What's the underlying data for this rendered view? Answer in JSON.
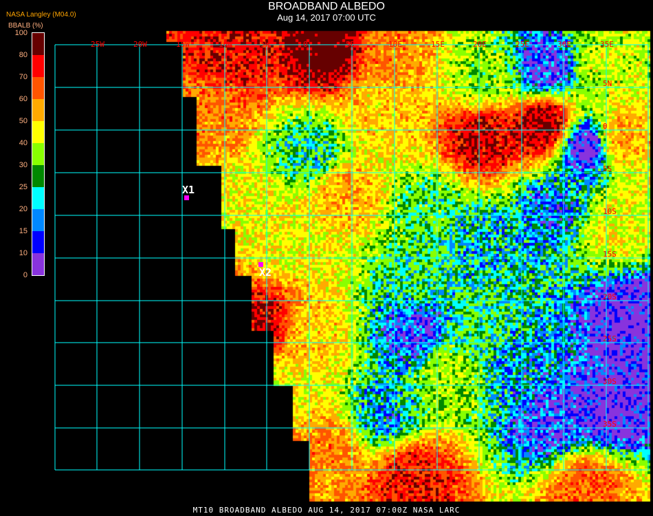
{
  "header": {
    "title": "BROADBAND ALBEDO",
    "subtitle": "Aug 14, 2017 07:00 UTC"
  },
  "legend": {
    "source": "NASA Langley (M04.0)",
    "parameter": "BBALB (%)",
    "ticks": [
      "100",
      "80",
      "70",
      "60",
      "50",
      "40",
      "30",
      "25",
      "20",
      "15",
      "10",
      "0"
    ],
    "bins": [
      {
        "range": "80-100",
        "color": "#660000"
      },
      {
        "range": "70-80",
        "color": "#ff0000"
      },
      {
        "range": "60-70",
        "color": "#ff5500"
      },
      {
        "range": "50-60",
        "color": "#ffaa00"
      },
      {
        "range": "40-50",
        "color": "#ffff00"
      },
      {
        "range": "30-40",
        "color": "#88ff00"
      },
      {
        "range": "25-30",
        "color": "#008800"
      },
      {
        "range": "20-25",
        "color": "#00ffff"
      },
      {
        "range": "15-20",
        "color": "#0088ff"
      },
      {
        "range": "10-15",
        "color": "#0000ff"
      },
      {
        "range": "0-10",
        "color": "#8833dd"
      }
    ]
  },
  "grid": {
    "color": "#00ffff",
    "label_color": "#ff0000",
    "longitude_labels": [
      "25W",
      "20W",
      "15W",
      "10W",
      "5W",
      "0",
      "5E",
      "10E",
      "15E",
      "20E",
      "25E",
      "30E",
      "35E"
    ],
    "latitude_labels": [
      "5N",
      "0",
      "5S",
      "10S",
      "15S",
      "20S",
      "25S",
      "30S",
      "35S"
    ]
  },
  "markers": [
    {
      "label": "X1",
      "color": "#ff00ff"
    },
    {
      "label": "X2",
      "color": "#ff00ff"
    }
  ],
  "footer": {
    "text": "MT10  BROADBAND ALBEDO   AUG 14, 2017 07:00Z   NASA LARC"
  }
}
